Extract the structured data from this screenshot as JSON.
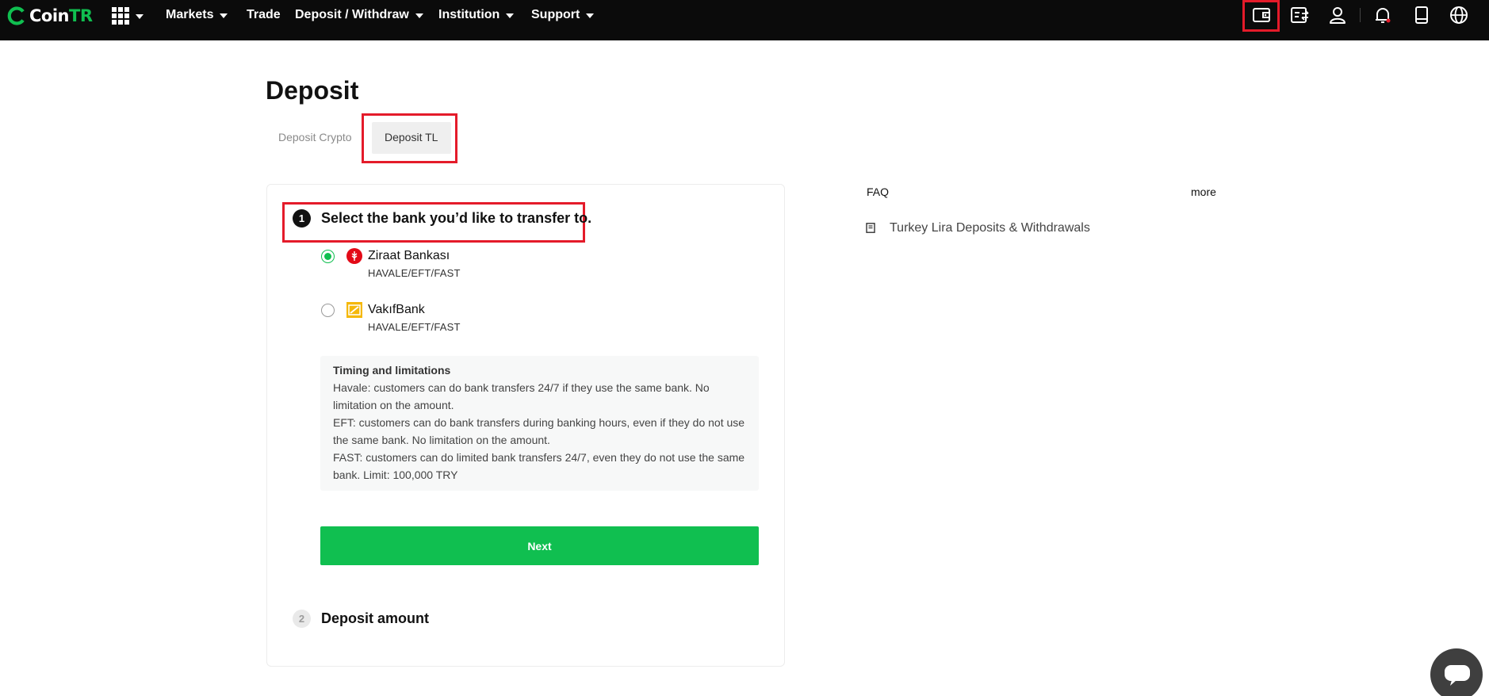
{
  "brand": {
    "name_part1": "Coin",
    "name_part2": "TR",
    "accent": "#10bf50"
  },
  "nav": {
    "items": [
      {
        "label": "Markets",
        "has_dropdown": true
      },
      {
        "label": "Trade",
        "has_dropdown": false
      },
      {
        "label": "Deposit / Withdraw",
        "has_dropdown": true
      },
      {
        "label": "Institution",
        "has_dropdown": true
      },
      {
        "label": "Support",
        "has_dropdown": true
      }
    ],
    "icons": [
      "apps-grid-icon",
      "wallet-icon",
      "orders-icon",
      "user-icon",
      "bell-icon",
      "mobile-app-icon",
      "globe-icon"
    ]
  },
  "page": {
    "title": "Deposit",
    "tabs": [
      {
        "label": "Deposit Crypto",
        "active": false
      },
      {
        "label": "Deposit TL",
        "active": true
      }
    ]
  },
  "steps": [
    {
      "number": "1",
      "title": "Select the bank you’d like to transfer to."
    },
    {
      "number": "2",
      "title": "Deposit amount"
    }
  ],
  "banks": [
    {
      "name": "Ziraat Bankası",
      "methods": "HAVALE/EFT/FAST",
      "selected": true,
      "icon": "ziraat-logo-icon"
    },
    {
      "name": "VakıfBank",
      "methods": "HAVALE/EFT/FAST",
      "selected": false,
      "icon": "vakifbank-logo-icon"
    }
  ],
  "info": {
    "title": "Timing and limitations",
    "lines": [
      "Havale: customers can do bank transfers 24/7 if they use the same bank. No",
      "limitation on the amount.",
      "EFT: customers can do bank transfers during banking hours, even if they do not use",
      "the same bank. No limitation on the amount.",
      "FAST: customers can do limited bank transfers 24/7, even they do not use the same",
      "bank. Limit: 100,000 TRY"
    ]
  },
  "next_label": "Next",
  "faq": {
    "title": "FAQ",
    "more_label": "more",
    "items": [
      {
        "label": "Turkey Lira Deposits & Withdrawals",
        "icon": "document-icon"
      }
    ]
  },
  "chat": {
    "icon": "chat-icon"
  }
}
